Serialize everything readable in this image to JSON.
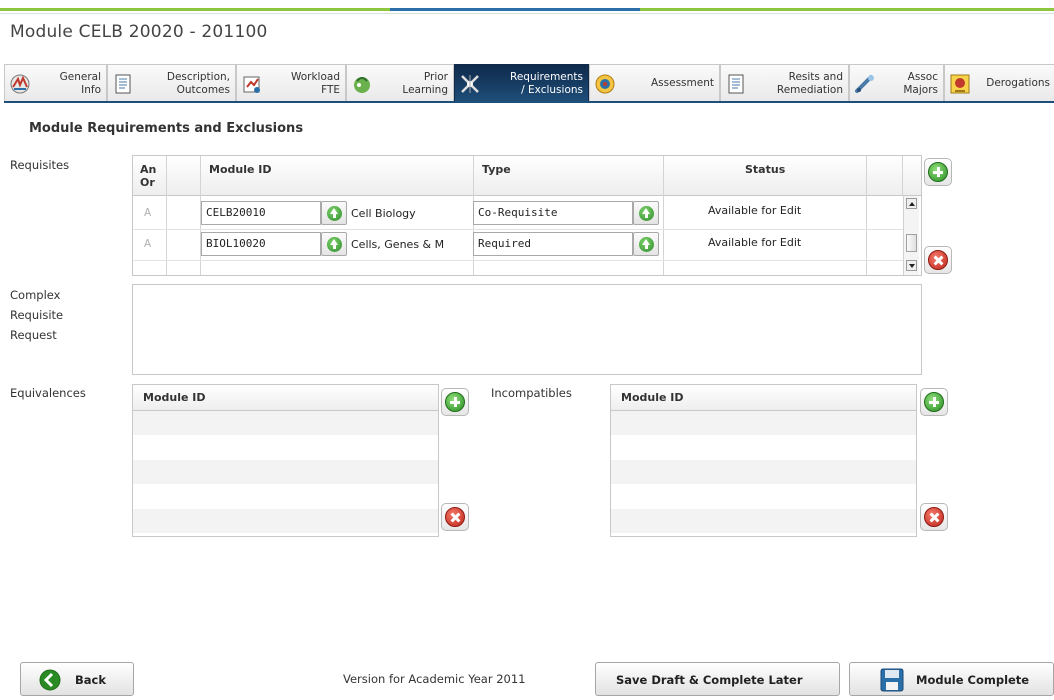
{
  "colors": {
    "accent_green": "#8dc63f",
    "accent_blue": "#1e4e7a",
    "active_tab": "#0f2a4a"
  },
  "window": {
    "title": "Module CELB 20020 - 201100"
  },
  "tabs": [
    {
      "label": "General\nInfo",
      "icon": "general-info-icon",
      "active": false
    },
    {
      "label": "Description,\nOutcomes",
      "icon": "document-icon",
      "active": false
    },
    {
      "label": "Workload\nFTE",
      "icon": "workload-icon",
      "active": false
    },
    {
      "label": "Prior\nLearning",
      "icon": "prior-learning-icon",
      "active": false
    },
    {
      "label": "Requirements\n/ Exclusions",
      "icon": "requirements-icon",
      "active": true
    },
    {
      "label": "Assessment",
      "icon": "assessment-icon",
      "active": false
    },
    {
      "label": "Resits and\nRemediation",
      "icon": "resits-icon",
      "active": false
    },
    {
      "label": "Assoc\nMajors",
      "icon": "assoc-majors-icon",
      "active": false
    },
    {
      "label": "Derogations",
      "icon": "derogations-icon",
      "active": false
    }
  ],
  "section_title": "Module Requirements and Exclusions",
  "requisites": {
    "label": "Requisites",
    "columns": {
      "andor": "An Or",
      "module_id": "Module ID",
      "type": "Type",
      "status": "Status"
    },
    "rows": [
      {
        "andor": "A",
        "module_id": "CELB20010",
        "module_name": "Cell Biology",
        "type": "Co-Requisite",
        "status": "Available for Edit"
      },
      {
        "andor": "A",
        "module_id": "BIOL10020",
        "module_name": "Cells, Genes & M",
        "type": "Required",
        "status": "Available for Edit"
      }
    ]
  },
  "complex_requisite": {
    "label": "Complex\nRequisite\nRequest",
    "value": ""
  },
  "equivalences": {
    "label": "Equivalences",
    "column": "Module ID"
  },
  "incompatibles": {
    "label": "Incompatibles",
    "column": "Module ID"
  },
  "footer": {
    "back_label": "Back",
    "version_text": "Version for Academic Year 2011",
    "save_draft_label": "Save Draft & Complete Later",
    "complete_label": "Module Complete"
  }
}
